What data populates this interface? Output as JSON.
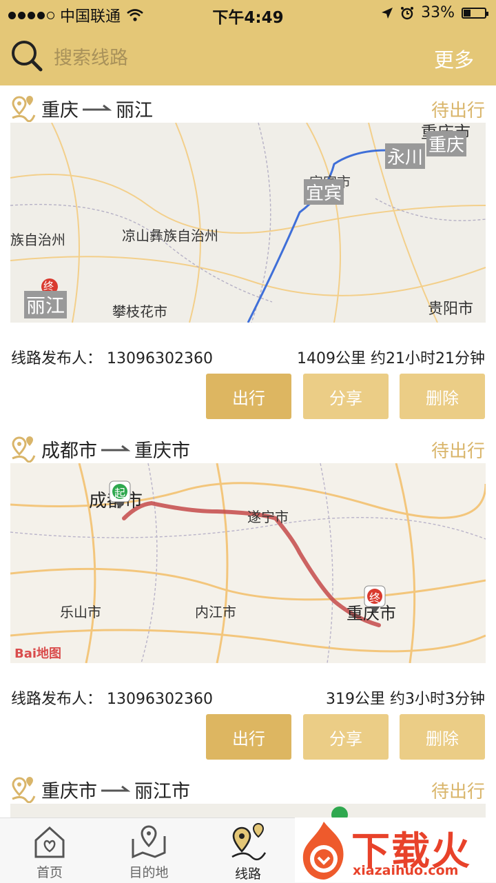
{
  "status_bar": {
    "carrier": "中国联通",
    "time": "下午4:49",
    "battery": "33%"
  },
  "header": {
    "search_placeholder": "搜索线路",
    "more_label": "更多"
  },
  "routes": [
    {
      "from": "重庆",
      "to": "丽江",
      "status": "待出行",
      "publisher_label": "线路发布人：",
      "publisher": "13096302360",
      "summary": "1409公里 约21小时21分钟",
      "map_labels": [
        "重庆市",
        "重庆",
        "永川",
        "宜宾市",
        "宜宾",
        "族自治州",
        "凉山彝族自治州",
        "丽江",
        "攀枝花市",
        "贵阳市"
      ]
    },
    {
      "from": "成都市",
      "to": "重庆市",
      "status": "待出行",
      "publisher_label": "线路发布人：",
      "publisher": "13096302360",
      "summary": "319公里 约3小时3分钟",
      "map_labels": [
        "成都市",
        "遂宁市",
        "乐山市",
        "内江市",
        "重庆市"
      ]
    },
    {
      "from": "重庆市",
      "to": "丽江市",
      "status": "待出行"
    }
  ],
  "buttons": {
    "go": "出行",
    "share": "分享",
    "delete": "删除"
  },
  "marker_labels": {
    "start": "起",
    "end": "终"
  },
  "map_logo": "Bai地图",
  "tabs": [
    {
      "label": "首页"
    },
    {
      "label": "目的地"
    },
    {
      "label": "线路"
    }
  ],
  "watermark": {
    "text": "下载火",
    "url": "xiazaihuo.com"
  },
  "colors": {
    "accent": "#e4c777",
    "button_primary": "#ddb661",
    "button_secondary": "#ebcd86",
    "status_text": "#d9b56a",
    "route_line": "#c44a4a",
    "map_route_blue": "#3f6fd8"
  }
}
